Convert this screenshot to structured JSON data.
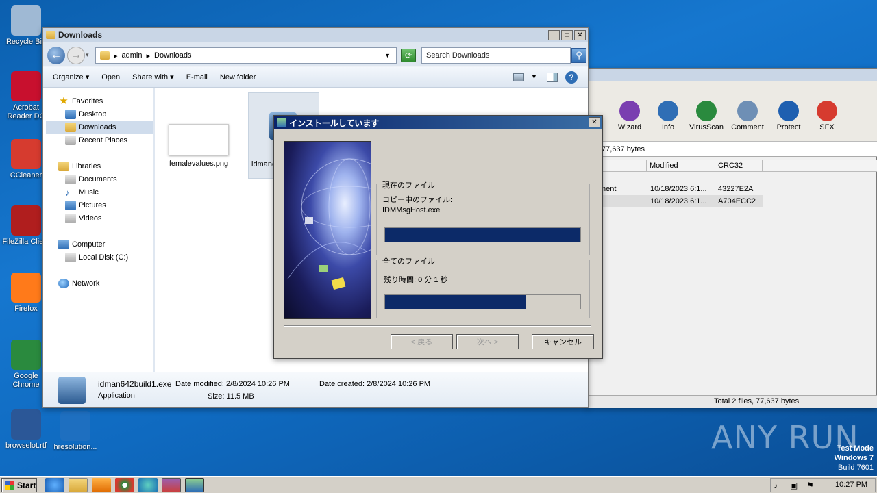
{
  "desktop": {
    "icons": [
      {
        "label": "Recycle Bin",
        "icon": "recycle-bin-icon",
        "color": "#9fb9d4"
      },
      {
        "label": "Acrobat Reader DC",
        "icon": "acrobat-icon",
        "color": "#c8102e"
      },
      {
        "label": "CCleaner",
        "icon": "ccleaner-icon",
        "color": "#d63b2f"
      },
      {
        "label": "FileZilla Client",
        "icon": "filezilla-icon",
        "color": "#b01e1e"
      },
      {
        "label": "Firefox",
        "icon": "firefox-icon",
        "color": "#ff7a1a"
      },
      {
        "label": "Google Chrome",
        "icon": "chrome-icon",
        "color": "#2a8a3e"
      },
      {
        "label": "browselot.rtf",
        "icon": "word-doc-icon",
        "color": "#2b5797"
      },
      {
        "label": "hresolution...",
        "icon": "blank-file-icon",
        "color": "#1e6fc0"
      }
    ],
    "watermark": "ANY RUN",
    "test_mode": [
      "Test Mode",
      "Windows 7",
      "Build 7601"
    ]
  },
  "explorer": {
    "title": "Downloads",
    "breadcrumb": [
      "admin",
      "Downloads"
    ],
    "search_placeholder": "Search Downloads",
    "commands": [
      "Organize ▾",
      "Open",
      "Share with ▾",
      "E-mail",
      "New folder"
    ],
    "nav": {
      "favorites": "Favorites",
      "favorites_items": [
        "Desktop",
        "Downloads",
        "Recent Places"
      ],
      "libraries": "Libraries",
      "libraries_items": [
        "Documents",
        "Music",
        "Pictures",
        "Videos"
      ],
      "computer": "Computer",
      "computer_items": [
        "Local Disk (C:)"
      ],
      "network": "Network"
    },
    "files": [
      {
        "name": "femalevalues.png"
      },
      {
        "name": "idman642build1.exe",
        "short": "idmane"
      }
    ],
    "details": {
      "name": "idman642build1.exe",
      "type": "Application",
      "date_modified_label": "Date modified:",
      "date_modified": "2/8/2024 10:26 PM",
      "date_created_label": "Date created:",
      "date_created": "2/8/2024 10:26 PM",
      "size_label": "Size:",
      "size": "11.5 MB"
    }
  },
  "archiver": {
    "toolbar": [
      "Wizard",
      "Info",
      "VirusScan",
      "Comment",
      "Protect",
      "SFX"
    ],
    "address_fragment": "77,637 bytes",
    "columns": [
      "Modified",
      "CRC32"
    ],
    "rows": [
      {
        "name_fragment": "ment",
        "modified": "10/18/2023 6:1...",
        "crc": "43227E2A"
      },
      {
        "name_fragment": "",
        "modified": "10/18/2023 6:1...",
        "crc": "A704ECC2"
      }
    ],
    "status": "Total 2 files, 77,637 bytes"
  },
  "installer": {
    "title": "インストールしています",
    "current_group": "現在のファイル",
    "copying_label": "コピー中のファイル:",
    "current_file": "IDMMsgHost.exe",
    "current_progress": 1.0,
    "all_group": "全てのファイル",
    "remaining": "残り時間: 0 分 1 秒",
    "all_progress": 0.72,
    "buttons": {
      "back": "< 戻る",
      "next": "次へ >",
      "cancel": "キャンセル"
    }
  },
  "taskbar": {
    "start": "Start",
    "time": "10:27 PM"
  }
}
